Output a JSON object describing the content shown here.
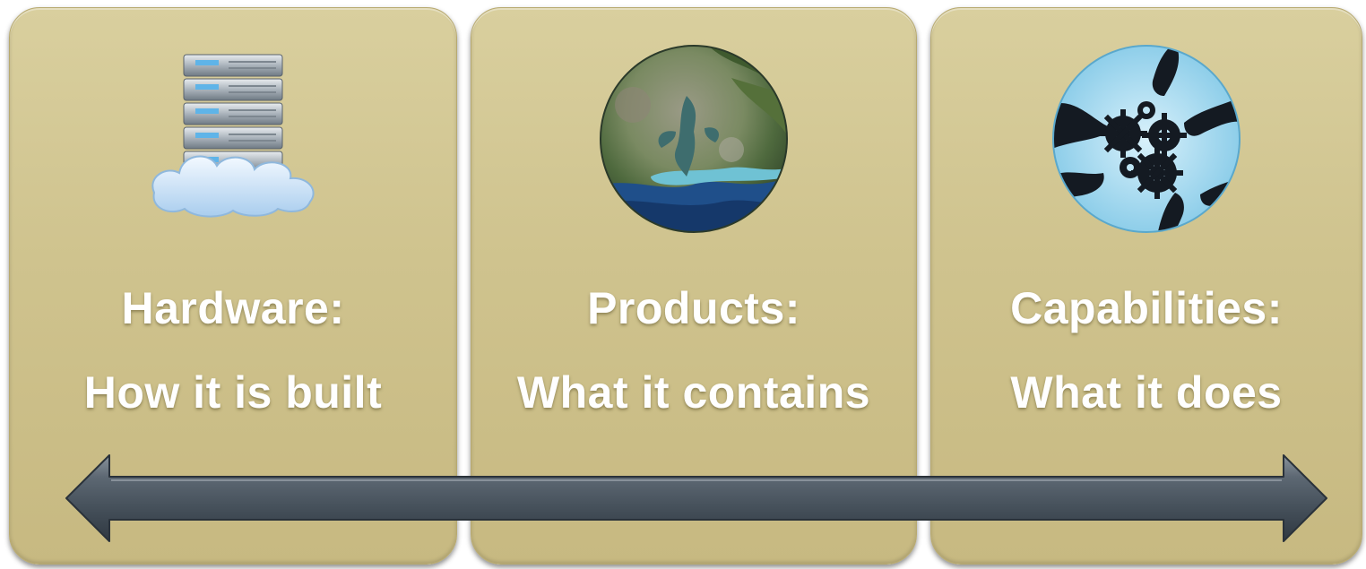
{
  "panels": [
    {
      "title": "Hardware:",
      "subtitle": "How it is built",
      "icon": "server-cloud-icon"
    },
    {
      "title": "Products:",
      "subtitle": "What it contains",
      "icon": "satellite-globe-icon"
    },
    {
      "title": "Capabilities:",
      "subtitle": "What it does",
      "icon": "hands-gears-icon"
    }
  ],
  "colors": {
    "panel_fill": "#cfc38e",
    "text": "#ffffff",
    "arrow": "#4f5b66"
  },
  "arrow": "double-headed-arrow"
}
